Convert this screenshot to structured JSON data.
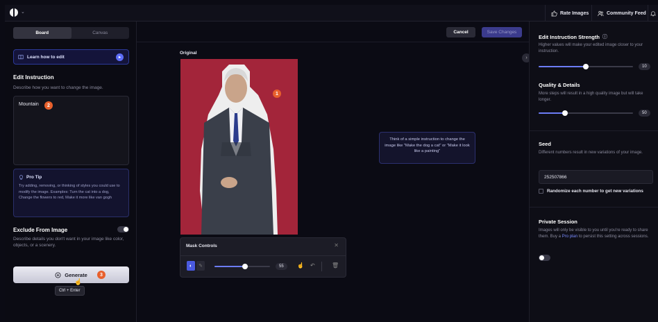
{
  "topbar": {
    "rate_label": "Rate Images",
    "community_label": "Community Feed"
  },
  "left": {
    "tabs": [
      "Board",
      "Canvas"
    ],
    "learn_label": "Learn how to edit",
    "edit_title": "Edit Instruction",
    "edit_desc": "Describe how you want to change the image.",
    "edit_value": "Mountain",
    "tip_title": "Pro Tip",
    "tip_body": "Try adding, removing, or thinking of styles you could use to modify the image. Examples: Turn the cat into a dog, Change the flowers to red, Make it more like van gogh",
    "exclude_title": "Exclude From Image",
    "exclude_desc": "Describe details you don't want in your image like color, objects, or a scenery.",
    "generate_label": "Generate",
    "shortcut": "Ctrl + Enter"
  },
  "badges": [
    "1",
    "2",
    "3"
  ],
  "center": {
    "cancel_label": "Cancel",
    "save_label": "Save Changes",
    "original_label": "Original",
    "mask_title": "Mask Controls",
    "brush_value": "55",
    "brush_fraction": 0.55,
    "hint": "Think of a simple instruction to change the image like \"Make the dog a cat\" or \"Make it look like a painting\""
  },
  "right": {
    "strength_title": "Edit Instruction Strength",
    "strength_desc": "Higher values will make your edited image closer to your instruction.",
    "strength_value": "10",
    "strength_fraction": 0.5,
    "quality_title": "Quality & Details",
    "quality_desc": "More steps will result in a high quality image but will take longer.",
    "quality_value": "50",
    "quality_fraction": 0.28,
    "seed_title": "Seed",
    "seed_desc": "Different numbers result in new variations of your image.",
    "seed_value": "252507866",
    "randomize_label": "Randomize each number to get new variations",
    "private_title": "Private Session",
    "private_desc_before": "Images will only be visible to you until you're ready to share them. Buy a ",
    "private_link": "Pro plan",
    "private_desc_after": " to persist this setting across sessions."
  },
  "colors": {
    "accent": "#6c7cf6",
    "badge": "#e8602c",
    "photo_bg": "#a3253a"
  }
}
